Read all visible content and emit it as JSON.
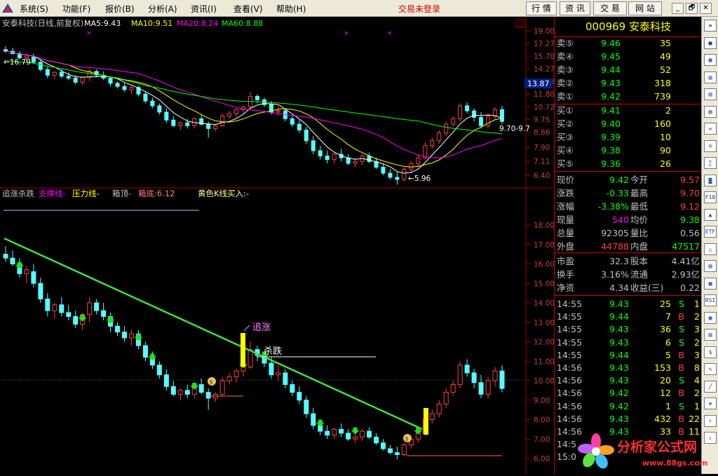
{
  "menubar": {
    "items": [
      "系统(S)",
      "功能(F)",
      "报价(B)",
      "分析(A)",
      "资讯(I)",
      "查看(V)",
      "帮助(H)"
    ],
    "trade_status": "交易未登录",
    "tabs": [
      "行 情",
      "资 讯",
      "交 易",
      "网 站"
    ],
    "window_buttons": [
      "_",
      "🗗",
      "✕"
    ]
  },
  "main_chart": {
    "title": "安泰科技(日线,前复权)",
    "ma": [
      {
        "label": "MA5:9.43",
        "color": "#ffffff"
      },
      {
        "label": "MA10:9.51",
        "color": "#ffff00"
      },
      {
        "label": "MA20:8.24",
        "color": "#ff00ff"
      },
      {
        "label": "MA60:8.88",
        "color": "#00ff00"
      }
    ],
    "ticks": [
      "19.00",
      "17.27",
      "15.70",
      "14.27",
      "12.98",
      "11.80",
      "10.72",
      "9.75",
      "8.86",
      "7.90",
      "7.11",
      "6.40"
    ],
    "high_label": "16.79",
    "low_label": "5.96",
    "right_label": "9.70-9.7",
    "price_box": "13.87"
  },
  "indicator": {
    "name": "追涨杀跌",
    "support": "支撑线-",
    "pressure": "压力线-",
    "box_top": "箱顶-",
    "box_bottom": "箱底:6.12",
    "yellow_buy": "黄色K线买入:-",
    "ticks": [
      "18.00",
      "17.00",
      "16.00",
      "15.00",
      "14.00",
      "13.00",
      "12.00",
      "11.00",
      "10.00",
      "9.00",
      "8.00",
      "7.00",
      "6.00"
    ],
    "label_up": "追涨",
    "label_down": "杀跌"
  },
  "chart_data": {
    "type": "candlestick",
    "ohlc": [
      [
        16.5,
        16.9,
        16.1,
        16.3
      ],
      [
        16.3,
        16.7,
        15.9,
        16.0
      ],
      [
        16.0,
        16.3,
        15.3,
        15.5
      ],
      [
        15.5,
        15.9,
        15.0,
        15.7
      ],
      [
        15.6,
        16.0,
        14.8,
        15.0
      ],
      [
        15.0,
        15.3,
        14.0,
        14.2
      ],
      [
        14.2,
        14.5,
        13.3,
        13.6
      ],
      [
        13.6,
        14.0,
        13.2,
        13.9
      ],
      [
        13.9,
        14.3,
        13.3,
        13.5
      ],
      [
        13.5,
        13.9,
        13.1,
        13.3
      ],
      [
        13.3,
        13.6,
        12.7,
        12.9
      ],
      [
        12.9,
        13.5,
        12.6,
        13.4
      ],
      [
        13.4,
        14.3,
        13.0,
        14.0
      ],
      [
        14.0,
        14.2,
        13.4,
        13.6
      ],
      [
        13.6,
        14.0,
        13.1,
        13.3
      ],
      [
        13.3,
        13.5,
        12.5,
        12.8
      ],
      [
        12.8,
        13.0,
        12.3,
        12.5
      ],
      [
        12.5,
        12.8,
        12.0,
        12.2
      ],
      [
        12.2,
        12.6,
        11.8,
        12.4
      ],
      [
        12.4,
        12.6,
        11.6,
        11.8
      ],
      [
        11.8,
        12.0,
        11.0,
        11.2
      ],
      [
        11.2,
        11.5,
        10.6,
        10.8
      ],
      [
        10.8,
        11.0,
        10.1,
        10.3
      ],
      [
        10.3,
        10.6,
        9.5,
        9.7
      ],
      [
        9.7,
        10.0,
        9.2,
        9.3
      ],
      [
        9.3,
        9.6,
        9.0,
        9.5
      ],
      [
        9.5,
        9.8,
        9.1,
        9.3
      ],
      [
        9.3,
        9.9,
        9.1,
        9.8
      ],
      [
        9.8,
        10.1,
        9.3,
        9.4
      ],
      [
        9.4,
        9.6,
        8.5,
        9.1
      ],
      [
        9.1,
        9.4,
        8.9,
        9.3
      ],
      [
        9.3,
        10.2,
        9.2,
        10.0
      ],
      [
        10.0,
        10.4,
        9.8,
        10.2
      ],
      [
        10.2,
        10.6,
        9.9,
        10.5
      ],
      [
        10.5,
        10.8,
        10.2,
        10.7
      ],
      [
        10.7,
        12.0,
        10.6,
        11.6
      ],
      [
        11.6,
        11.8,
        11.0,
        11.3
      ],
      [
        11.3,
        11.5,
        10.7,
        10.9
      ],
      [
        10.9,
        11.2,
        10.1,
        10.3
      ],
      [
        10.3,
        10.8,
        10.0,
        10.4
      ],
      [
        10.4,
        10.6,
        9.6,
        9.8
      ],
      [
        9.8,
        10.0,
        9.2,
        9.4
      ],
      [
        9.4,
        9.7,
        8.8,
        9.0
      ],
      [
        9.0,
        9.2,
        8.1,
        8.3
      ],
      [
        8.3,
        8.6,
        7.5,
        7.7
      ],
      [
        7.7,
        8.0,
        7.2,
        7.4
      ],
      [
        7.4,
        7.7,
        7.0,
        7.2
      ],
      [
        7.2,
        7.6,
        7.0,
        7.5
      ],
      [
        7.5,
        7.8,
        7.1,
        7.3
      ],
      [
        7.3,
        7.5,
        6.9,
        7.0
      ],
      [
        7.0,
        7.3,
        6.8,
        7.1
      ],
      [
        7.1,
        7.5,
        6.9,
        7.4
      ],
      [
        7.4,
        7.6,
        7.0,
        7.1
      ],
      [
        7.1,
        7.3,
        6.7,
        6.8
      ],
      [
        6.8,
        7.0,
        6.4,
        6.5
      ],
      [
        6.5,
        6.7,
        6.2,
        6.3
      ],
      [
        6.3,
        6.6,
        5.96,
        6.2
      ],
      [
        6.2,
        6.8,
        6.1,
        6.7
      ],
      [
        6.7,
        7.1,
        6.5,
        7.0
      ],
      [
        7.0,
        7.5,
        6.8,
        7.3
      ],
      [
        7.3,
        8.2,
        7.2,
        8.0
      ],
      [
        8.0,
        8.5,
        7.8,
        8.3
      ],
      [
        8.3,
        9.0,
        8.1,
        8.8
      ],
      [
        8.8,
        9.6,
        8.6,
        9.4
      ],
      [
        9.4,
        10.0,
        9.2,
        9.8
      ],
      [
        9.8,
        11.0,
        9.6,
        10.8
      ],
      [
        10.8,
        11.1,
        10.2,
        10.4
      ],
      [
        10.4,
        10.6,
        9.6,
        9.9
      ],
      [
        9.9,
        10.3,
        9.1,
        9.3
      ],
      [
        9.3,
        10.2,
        9.1,
        10.0
      ],
      [
        10.0,
        10.7,
        9.7,
        10.5
      ],
      [
        10.5,
        10.8,
        9.4,
        9.6
      ]
    ],
    "ma_colors": [
      "#ffffff",
      "#ffff00",
      "#ff00ff",
      "#00ff00"
    ],
    "up_color": "#ff4040",
    "down_color": "#54ffff"
  },
  "stock": {
    "code": "000969",
    "name": "安泰科技"
  },
  "order_book": {
    "asks": [
      {
        "label": "卖⑤",
        "price": "9.46",
        "vol": "35"
      },
      {
        "label": "卖④",
        "price": "9.45",
        "vol": "49"
      },
      {
        "label": "卖③",
        "price": "9.44",
        "vol": "52"
      },
      {
        "label": "卖②",
        "price": "9.43",
        "vol": "318"
      },
      {
        "label": "卖①",
        "price": "9.42",
        "vol": "739"
      }
    ],
    "bids": [
      {
        "label": "买①",
        "price": "9.41",
        "vol": "2"
      },
      {
        "label": "买②",
        "price": "9.40",
        "vol": "160"
      },
      {
        "label": "买③",
        "price": "9.39",
        "vol": "10"
      },
      {
        "label": "买④",
        "price": "9.38",
        "vol": "90"
      },
      {
        "label": "买⑤",
        "price": "9.36",
        "vol": "26"
      }
    ]
  },
  "stats": [
    {
      "l1": "现价",
      "v1": "9.42",
      "c1": "#00ff00",
      "l2": "今开",
      "v2": "9.57",
      "c2": "#ff4040"
    },
    {
      "l1": "涨跌",
      "v1": "-0.33",
      "c1": "#00ff00",
      "l2": "最高",
      "v2": "9.70",
      "c2": "#ff4040"
    },
    {
      "l1": "涨幅",
      "v1": "-3.38%",
      "c1": "#00ff00",
      "l2": "最低",
      "v2": "9.12",
      "c2": "#ff4040"
    },
    {
      "l1": "现量",
      "v1": "540",
      "c1": "#ff00ff",
      "l2": "均价",
      "v2": "9.38",
      "c2": "#00ff00"
    },
    {
      "l1": "总量",
      "v1": "92305",
      "c1": "#c0c0c0",
      "l2": "量比",
      "v2": "0.56",
      "c2": "#c0c0c0"
    },
    {
      "l1": "外盘",
      "v1": "44788",
      "c1": "#ff4040",
      "l2": "内盘",
      "v2": "47517",
      "c2": "#00ff00"
    }
  ],
  "fundamentals": [
    {
      "l1": "市盈",
      "v1": "32.3",
      "l2": "股本",
      "v2": "4.41亿"
    },
    {
      "l1": "换手",
      "v1": "3.16%",
      "l2": "流通",
      "v2": "2.93亿"
    },
    {
      "l1": "净资",
      "v1": "4.34",
      "l2": "收益(三)",
      "v2": "0.22"
    }
  ],
  "ticks_list": [
    {
      "time": "14:55",
      "price": "9.43",
      "vol": "25",
      "side": "S",
      "n": "1"
    },
    {
      "time": "14:55",
      "price": "9.44",
      "vol": "7",
      "side": "B",
      "n": "2"
    },
    {
      "time": "14:55",
      "price": "9.43",
      "vol": "36",
      "side": "S",
      "n": "3"
    },
    {
      "time": "14:55",
      "price": "9.43",
      "vol": "6",
      "side": "S",
      "n": "2"
    },
    {
      "time": "14:55",
      "price": "9.44",
      "vol": "5",
      "side": "B",
      "n": "3"
    },
    {
      "time": "14:56",
      "price": "9.43",
      "vol": "153",
      "side": "B",
      "n": "8"
    },
    {
      "time": "14:56",
      "price": "9.43",
      "vol": "20",
      "side": "S",
      "n": "4"
    },
    {
      "time": "14:56",
      "price": "9.42",
      "vol": "12",
      "side": "B",
      "n": "2"
    },
    {
      "time": "14:56",
      "price": "9.42",
      "vol": "1",
      "side": "S",
      "n": "1"
    },
    {
      "time": "14:56",
      "price": "9.43",
      "vol": "432",
      "side": "B",
      "n": "22"
    },
    {
      "time": "14:56",
      "price": "9.43",
      "vol": "33",
      "side": "B",
      "n": "11"
    },
    {
      "time": "14:5",
      "price": "",
      "vol": "",
      "side": "",
      "n": ""
    },
    {
      "time": "15:0",
      "price": "",
      "vol": "",
      "side": "",
      "n": ""
    }
  ],
  "toolbar": {
    "tools": [
      "≡",
      "■",
      "▦",
      "▤",
      "▥",
      "▧",
      "✉",
      "☺",
      "∑",
      "◙",
      "F10",
      "▲",
      "ETF",
      "△",
      "▨",
      "▩",
      "RSI",
      "▣",
      "▤",
      "$",
      "✎",
      "╱",
      "✥",
      "↑",
      "↓"
    ]
  },
  "watermark": {
    "name": "分析家公式网",
    "url": "www.88gs.com"
  }
}
